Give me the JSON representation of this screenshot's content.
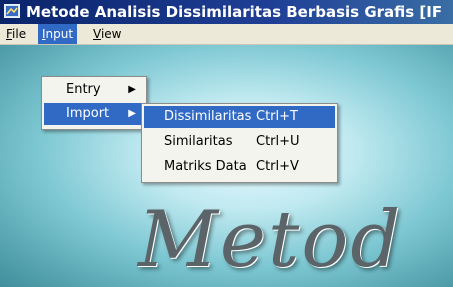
{
  "window": {
    "title": "Metode Analisis Dissimilaritas  Berbasis Grafis [IF"
  },
  "menubar": {
    "items": [
      {
        "mnemonic": "F",
        "rest": "ile"
      },
      {
        "mnemonic": "I",
        "rest": "nput"
      },
      {
        "mnemonic": "V",
        "rest": "iew"
      }
    ]
  },
  "input_menu": {
    "items": [
      {
        "label": "Entry"
      },
      {
        "label": "Import"
      }
    ]
  },
  "import_menu": {
    "items": [
      {
        "label": "Dissimilaritas",
        "shortcut": "Ctrl+T"
      },
      {
        "label": "Similaritas",
        "shortcut": "Ctrl+U"
      },
      {
        "label": "Matriks Data",
        "shortcut": "Ctrl+V"
      }
    ]
  },
  "canvas": {
    "logo_text": "Metod"
  },
  "colors": {
    "title_bar": "#0a246a",
    "menu_highlight": "#316ac5",
    "menu_background": "#ece9d8"
  }
}
